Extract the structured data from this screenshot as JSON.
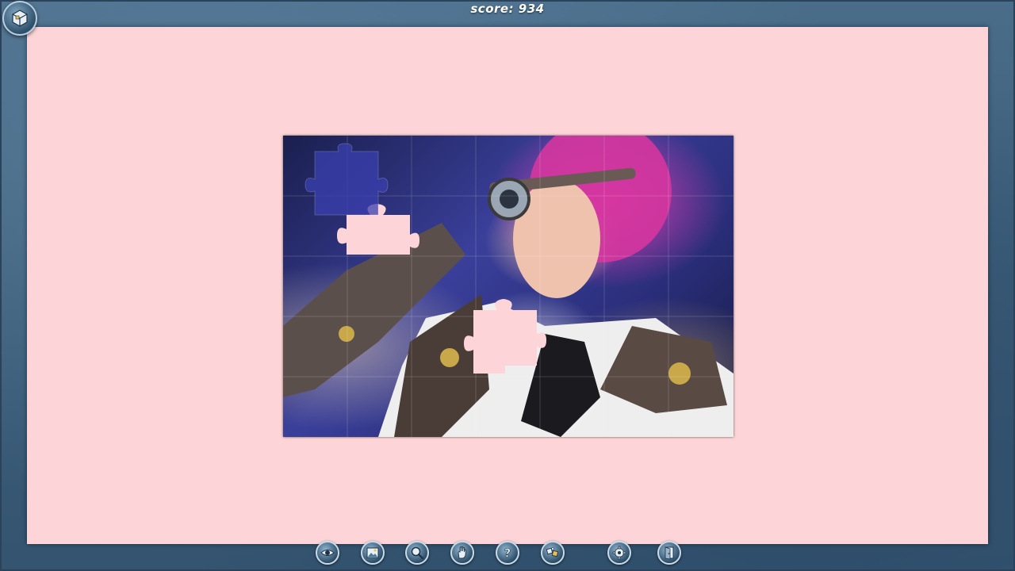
{
  "hud": {
    "score_text": "score: 934"
  },
  "menu_button": {
    "icon": "puzzle-box-icon"
  },
  "toolbar": {
    "buttons": [
      {
        "icon": "eye-icon"
      },
      {
        "icon": "image-preview-icon"
      },
      {
        "icon": "magnifier-icon"
      },
      {
        "icon": "hand-icon"
      },
      {
        "icon": "help-icon"
      },
      {
        "icon": "shuffle-pieces-icon"
      },
      {
        "icon": "gear-icon"
      },
      {
        "icon": "exit-door-icon"
      }
    ]
  },
  "colors": {
    "board_background": "#fdd5d8",
    "frame": "#3b5c78",
    "accent": "#c8dbe8"
  }
}
